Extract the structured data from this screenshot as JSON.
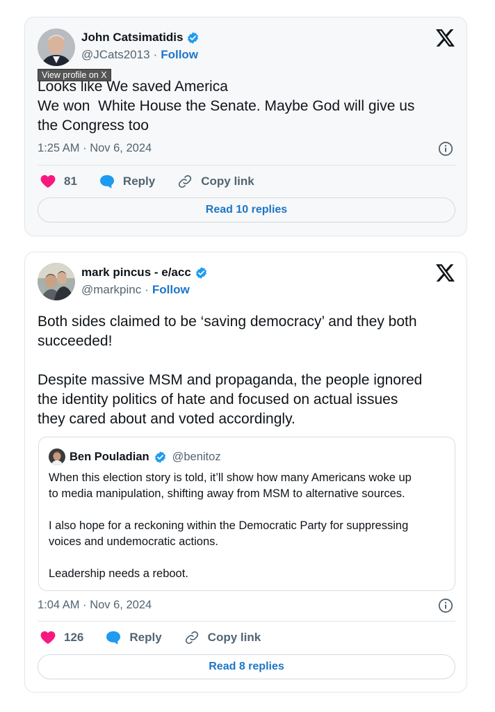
{
  "tweets": [
    {
      "author_name": "John Catsimatidis",
      "handle": "@JCats2013",
      "separator": "·",
      "follow_label": "Follow",
      "tooltip": "View profile on X",
      "text": "Looks like We saved America\nWe won  White House the Senate. Maybe God will give us\nthe Congress too",
      "timestamp": "1:25 AM · Nov 6, 2024",
      "likes": "81",
      "reply_label": "Reply",
      "copy_label": "Copy link",
      "read_replies": "Read 10 replies"
    },
    {
      "author_name": "mark pincus - e/acc",
      "handle": "@markpinc",
      "separator": "·",
      "follow_label": "Follow",
      "text": "Both sides claimed to be ‘saving democracy’ and they both\nsucceeded!\n\nDespite massive MSM and propaganda, the people ignored\nthe identity politics of hate and focused on actual issues\nthey cared about and voted accordingly.",
      "quote": {
        "author_name": "Ben Pouladian",
        "handle": "@benitoz",
        "text": "When this election story is told, it’ll show how many Americans woke up\nto media manipulation, shifting away from MSM to alternative sources.\n\nI also hope for a reckoning within the Democratic Party for suppressing\nvoices and undemocratic actions.\n\nLeadership needs a reboot."
      },
      "timestamp": "1:04 AM · Nov 6, 2024",
      "likes": "126",
      "reply_label": "Reply",
      "copy_label": "Copy link",
      "read_replies": "Read 8 replies"
    }
  ],
  "colors": {
    "heart": "#f91880",
    "reply": "#1d9bf0",
    "link": "#1d76c8",
    "verified": "#1d9bf0"
  },
  "icons": [
    "verified-badge-icon",
    "x-logo-icon",
    "info-icon",
    "heart-icon",
    "reply-bubble-icon",
    "link-icon"
  ]
}
